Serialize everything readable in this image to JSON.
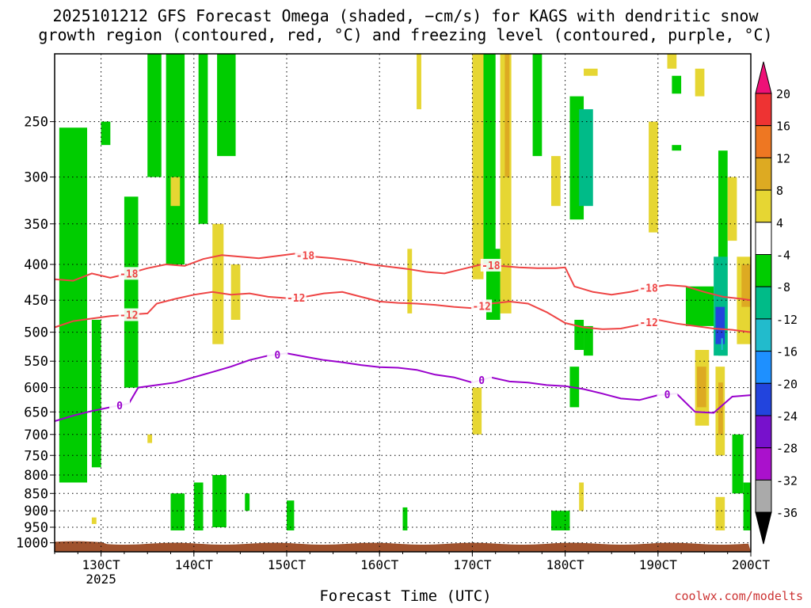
{
  "title_line1": "2025101212 GFS Forecast Omega (shaded, −cm/s) for KAGS with dendritic snow",
  "title_line2": "growth region (contoured, red, °C) and freezing level (contoured, purple, °C)",
  "credit": "coolwx.com/modelts",
  "colors": {
    "dgz_contour": "#ee4444",
    "freezing_contour": "#9900cc",
    "terrain": "#a0522d",
    "grid": "#000000"
  },
  "chart_data": {
    "type": "heatmap",
    "title": "2025101212 GFS Forecast Omega (shaded, −cm/s) for KAGS with dendritic snow growth region (contoured, red, °C) and freezing level (contoured, purple, °C)",
    "xlabel": "Forecast Time (UTC)",
    "ylabel": "",
    "x_ticks": [
      "130CT",
      "140CT",
      "150CT",
      "160CT",
      "170CT",
      "180CT",
      "190CT",
      "200CT"
    ],
    "x_tick_values": [
      13,
      14,
      15,
      16,
      17,
      18,
      19,
      20
    ],
    "x_sublabel": "2025",
    "xlim": [
      12.5,
      20.0
    ],
    "y_ticks": [
      250,
      300,
      350,
      400,
      450,
      500,
      550,
      600,
      650,
      700,
      750,
      800,
      850,
      900,
      950,
      1000
    ],
    "ylim": [
      1030,
      200
    ],
    "y_scale": "log",
    "grid": true,
    "colorbar": {
      "ticks": [
        20,
        16,
        12,
        8,
        4,
        -4,
        -8,
        -12,
        -16,
        -20,
        -24,
        -28,
        -32,
        -36
      ],
      "bins": [
        {
          "from": 16,
          "to": 20,
          "color": "#ee3333"
        },
        {
          "from": 12,
          "to": 16,
          "color": "#ee7722"
        },
        {
          "from": 8,
          "to": 12,
          "color": "#ddaa22"
        },
        {
          "from": 4,
          "to": 8,
          "color": "#e6d633"
        },
        {
          "from": -4,
          "to": 4,
          "color": "#ffffff"
        },
        {
          "from": -8,
          "to": -4,
          "color": "#00cc00"
        },
        {
          "from": -12,
          "to": -8,
          "color": "#00bb88"
        },
        {
          "from": -16,
          "to": -12,
          "color": "#22bbcc"
        },
        {
          "from": -20,
          "to": -16,
          "color": "#1e90ff"
        },
        {
          "from": -24,
          "to": -20,
          "color": "#2244dd"
        },
        {
          "from": -28,
          "to": -24,
          "color": "#7711cc"
        },
        {
          "from": -32,
          "to": -28,
          "color": "#aa11cc"
        },
        {
          "from": -36,
          "to": -32,
          "color": "#aaaaaa"
        }
      ],
      "top_arrow_color": "#ee1177",
      "bottom_arrow_color": "#000000"
    },
    "series": [
      {
        "name": "-18",
        "color": "#ee4444",
        "x": [
          12.5,
          12.7,
          12.9,
          13.1,
          13.3,
          13.5,
          13.7,
          13.9,
          14.1,
          14.3,
          14.5,
          14.7,
          14.9,
          15.1,
          15.3,
          15.5,
          15.7,
          15.9,
          16.1,
          16.3,
          16.5,
          16.7,
          16.9,
          17.1,
          17.3,
          17.5,
          17.7,
          17.9,
          18.0,
          18.1,
          18.3,
          18.5,
          18.7,
          18.9,
          19.1,
          19.3,
          19.5,
          19.7,
          19.9,
          20.0
        ],
        "y": [
          420,
          422,
          412,
          418,
          412,
          405,
          400,
          402,
          393,
          388,
          390,
          392,
          389,
          386,
          390,
          392,
          395,
          400,
          403,
          406,
          410,
          412,
          406,
          400,
          402,
          404,
          405,
          405,
          404,
          430,
          438,
          442,
          438,
          432,
          428,
          430,
          438,
          445,
          448,
          450
        ],
        "labels": [
          {
            "x": 13.3,
            "text": "-18"
          },
          {
            "x": 15.2,
            "text": "-18"
          },
          {
            "x": 17.2,
            "text": "-18"
          },
          {
            "x": 18.9,
            "text": "-18"
          }
        ]
      },
      {
        "name": "-12",
        "color": "#ee4444",
        "x": [
          12.5,
          12.7,
          12.9,
          13.1,
          13.3,
          13.5,
          13.6,
          13.8,
          14.0,
          14.2,
          14.4,
          14.6,
          14.8,
          15.0,
          15.2,
          15.4,
          15.6,
          15.8,
          16.0,
          16.2,
          16.4,
          16.6,
          16.8,
          17.0,
          17.2,
          17.4,
          17.6,
          17.8,
          18.0,
          18.2,
          18.4,
          18.6,
          18.8,
          19.0,
          19.2,
          19.4,
          19.6,
          19.8,
          20.0
        ],
        "y": [
          492,
          482,
          478,
          474,
          472,
          470,
          455,
          448,
          442,
          438,
          442,
          440,
          445,
          447,
          445,
          440,
          438,
          445,
          452,
          454,
          455,
          457,
          460,
          462,
          455,
          452,
          455,
          468,
          485,
          492,
          495,
          494,
          488,
          480,
          486,
          490,
          494,
          496,
          500
        ],
        "labels": [
          {
            "x": 13.3,
            "text": "-12"
          },
          {
            "x": 15.1,
            "text": "-12"
          },
          {
            "x": 17.1,
            "text": "-12"
          },
          {
            "x": 18.9,
            "text": "-12"
          }
        ]
      },
      {
        "name": "0",
        "color": "#9900cc",
        "x": [
          12.5,
          12.7,
          12.9,
          13.1,
          13.3,
          13.4,
          13.6,
          13.8,
          14.0,
          14.2,
          14.4,
          14.6,
          14.8,
          15.0,
          15.2,
          15.4,
          15.6,
          15.8,
          16.0,
          16.2,
          16.4,
          16.6,
          16.8,
          17.0,
          17.2,
          17.4,
          17.6,
          17.8,
          18.0,
          18.2,
          18.4,
          18.6,
          18.8,
          19.0,
          19.2,
          19.4,
          19.6,
          19.8,
          20.0
        ],
        "y": [
          670,
          658,
          648,
          640,
          632,
          600,
          595,
          590,
          580,
          570,
          560,
          548,
          540,
          536,
          542,
          548,
          552,
          557,
          561,
          562,
          566,
          575,
          580,
          590,
          580,
          588,
          590,
          595,
          597,
          603,
          612,
          622,
          625,
          615,
          612,
          650,
          652,
          618,
          615
        ],
        "labels": [
          {
            "x": 13.2,
            "text": "0"
          },
          {
            "x": 14.9,
            "text": "0"
          },
          {
            "x": 17.1,
            "text": "0"
          },
          {
            "x": 19.1,
            "text": "0"
          }
        ]
      }
    ],
    "omega_regions": [
      {
        "x": [
          12.55,
          12.85
        ],
        "p": [
          255,
          820
        ],
        "value": -6
      },
      {
        "x": [
          12.9,
          13.0
        ],
        "p": [
          480,
          780
        ],
        "value": -6
      },
      {
        "x": [
          13.0,
          13.1
        ],
        "p": [
          250,
          270
        ],
        "value": -6
      },
      {
        "x": [
          13.25,
          13.4
        ],
        "p": [
          320,
          600
        ],
        "value": -6
      },
      {
        "x": [
          13.5,
          13.65
        ],
        "p": [
          200,
          300
        ],
        "value": -6
      },
      {
        "x": [
          13.7,
          13.9
        ],
        "p": [
          200,
          400
        ],
        "value": -6
      },
      {
        "x": [
          14.05,
          14.15
        ],
        "p": [
          200,
          350
        ],
        "value": -6
      },
      {
        "x": [
          14.25,
          14.45
        ],
        "p": [
          200,
          280
        ],
        "value": -6
      },
      {
        "x": [
          13.75,
          13.9
        ],
        "p": [
          850,
          960
        ],
        "value": -6
      },
      {
        "x": [
          14.0,
          14.1
        ],
        "p": [
          820,
          960
        ],
        "value": -6
      },
      {
        "x": [
          14.2,
          14.35
        ],
        "p": [
          800,
          950
        ],
        "value": -6
      },
      {
        "x": [
          14.55,
          14.6
        ],
        "p": [
          850,
          900
        ],
        "value": -6
      },
      {
        "x": [
          15.0,
          15.08
        ],
        "p": [
          870,
          960
        ],
        "value": -6
      },
      {
        "x": [
          16.25,
          16.3
        ],
        "p": [
          890,
          960
        ],
        "value": -6
      },
      {
        "x": [
          17.1,
          17.25
        ],
        "p": [
          200,
          400
        ],
        "value": -6
      },
      {
        "x": [
          17.15,
          17.3
        ],
        "p": [
          380,
          480
        ],
        "value": -6
      },
      {
        "x": [
          17.65,
          17.75
        ],
        "p": [
          200,
          280
        ],
        "value": -6
      },
      {
        "x": [
          18.05,
          18.2
        ],
        "p": [
          230,
          345
        ],
        "value": -6
      },
      {
        "x": [
          18.15,
          18.3
        ],
        "p": [
          240,
          330
        ],
        "value": -12
      },
      {
        "x": [
          17.85,
          18.05
        ],
        "p": [
          900,
          960
        ],
        "value": -6
      },
      {
        "x": [
          18.05,
          18.15
        ],
        "p": [
          560,
          640
        ],
        "value": -6
      },
      {
        "x": [
          18.1,
          18.2
        ],
        "p": [
          480,
          530
        ],
        "value": -6
      },
      {
        "x": [
          18.2,
          18.3
        ],
        "p": [
          490,
          540
        ],
        "value": -6
      },
      {
        "x": [
          19.15,
          19.25
        ],
        "p": [
          215,
          228
        ],
        "value": -6
      },
      {
        "x": [
          19.15,
          19.25
        ],
        "p": [
          270,
          275
        ],
        "value": -6
      },
      {
        "x": [
          19.65,
          19.75
        ],
        "p": [
          275,
          540
        ],
        "value": -6
      },
      {
        "x": [
          19.3,
          19.6
        ],
        "p": [
          430,
          490
        ],
        "value": -6
      },
      {
        "x": [
          19.6,
          19.75
        ],
        "p": [
          390,
          540
        ],
        "value": -10
      },
      {
        "x": [
          19.62,
          19.72
        ],
        "p": [
          460,
          520
        ],
        "value": -22
      },
      {
        "x": [
          19.68,
          19.7
        ],
        "p": [
          510,
          530
        ],
        "value": -14
      },
      {
        "x": [
          19.8,
          19.92
        ],
        "p": [
          700,
          850
        ],
        "value": -6
      },
      {
        "x": [
          19.92,
          20.0
        ],
        "p": [
          820,
          960
        ],
        "value": -6
      },
      {
        "x": [
          19.85,
          20.0
        ],
        "p": [
          390,
          520
        ],
        "value": 6
      },
      {
        "x": [
          19.9,
          20.0
        ],
        "p": [
          400,
          460
        ],
        "value": 10
      },
      {
        "x": [
          19.4,
          19.55
        ],
        "p": [
          530,
          680
        ],
        "value": 6
      },
      {
        "x": [
          19.42,
          19.52
        ],
        "p": [
          560,
          640
        ],
        "value": 10
      },
      {
        "x": [
          19.62,
          19.72
        ],
        "p": [
          560,
          750
        ],
        "value": 6
      },
      {
        "x": [
          19.65,
          19.7
        ],
        "p": [
          590,
          700
        ],
        "value": 10
      },
      {
        "x": [
          19.62,
          19.72
        ],
        "p": [
          860,
          960
        ],
        "value": 6
      },
      {
        "x": [
          17.3,
          17.42
        ],
        "p": [
          200,
          470
        ],
        "value": 6
      },
      {
        "x": [
          17.35,
          17.4
        ],
        "p": [
          200,
          300
        ],
        "value": 10
      },
      {
        "x": [
          17.0,
          17.12
        ],
        "p": [
          200,
          420
        ],
        "value": 6
      },
      {
        "x": [
          14.2,
          14.32
        ],
        "p": [
          350,
          520
        ],
        "value": 6
      },
      {
        "x": [
          14.4,
          14.5
        ],
        "p": [
          400,
          480
        ],
        "value": 6
      },
      {
        "x": [
          16.4,
          16.45
        ],
        "p": [
          200,
          240
        ],
        "value": 6
      },
      {
        "x": [
          16.3,
          16.35
        ],
        "p": [
          380,
          470
        ],
        "value": 6
      },
      {
        "x": [
          17.0,
          17.1
        ],
        "p": [
          600,
          700
        ],
        "value": 6
      },
      {
        "x": [
          17.85,
          17.95
        ],
        "p": [
          280,
          330
        ],
        "value": 6
      },
      {
        "x": [
          18.2,
          18.35
        ],
        "p": [
          210,
          215
        ],
        "value": 6
      },
      {
        "x": [
          18.9,
          19.0
        ],
        "p": [
          250,
          360
        ],
        "value": 6
      },
      {
        "x": [
          19.1,
          19.2
        ],
        "p": [
          200,
          210
        ],
        "value": 6
      },
      {
        "x": [
          19.4,
          19.5
        ],
        "p": [
          210,
          230
        ],
        "value": 6
      },
      {
        "x": [
          19.75,
          19.85
        ],
        "p": [
          300,
          370
        ],
        "value": 6
      },
      {
        "x": [
          18.15,
          18.2
        ],
        "p": [
          820,
          860
        ],
        "value": 6
      },
      {
        "x": [
          18.15,
          18.2
        ],
        "p": [
          860,
          900
        ],
        "value": 6
      },
      {
        "x": [
          13.75,
          13.85
        ],
        "p": [
          300,
          330
        ],
        "value": 6
      },
      {
        "x": [
          12.9,
          12.95
        ],
        "p": [
          920,
          940
        ],
        "value": 6
      },
      {
        "x": [
          13.5,
          13.55
        ],
        "p": [
          700,
          720
        ],
        "value": 6
      }
    ]
  }
}
